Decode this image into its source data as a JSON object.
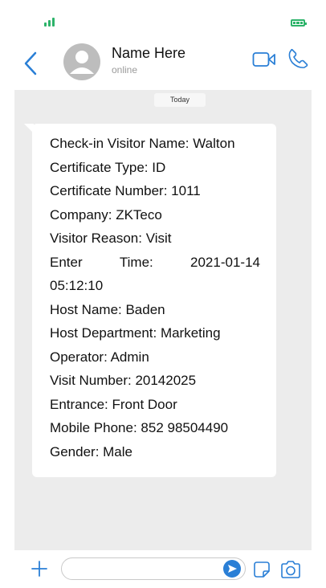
{
  "colors": {
    "accent": "#2a7fd6",
    "signal": "#2db36a",
    "chat_background": "#ececec",
    "bubble": "#ffffff"
  },
  "status_bar": {
    "signal_icon": "signal-bars-icon",
    "battery_icon": "battery-icon"
  },
  "header": {
    "back_icon": "chevron-left-icon",
    "contact_name": "Name Here",
    "contact_status": "online",
    "video_icon": "video-camera-icon",
    "phone_icon": "phone-icon"
  },
  "chat": {
    "date_label": "Today",
    "message_lines": [
      "Check-in Visitor Name: Walton",
      "Certificate Type: ID",
      "Certificate Number: 1011",
      "Company: ZKTeco",
      "Visitor Reason: Visit"
    ],
    "enter_time": {
      "label_1": "Enter",
      "label_2": "Time:",
      "date": "2021-01-14",
      "time": "05:12:10"
    },
    "message_lines_2": [
      "Host Name: Baden",
      "Host Department: Marketing",
      "Operator: Admin",
      "Visit Number: 20142025",
      "Entrance: Front Door",
      "Mobile Phone: 852 98504490",
      "Gender: Male"
    ]
  },
  "input_bar": {
    "plus_icon": "plus-icon",
    "input_value": "",
    "input_placeholder": "",
    "send_icon": "send-icon",
    "sticker_icon": "sticker-icon",
    "camera_icon": "camera-icon"
  }
}
